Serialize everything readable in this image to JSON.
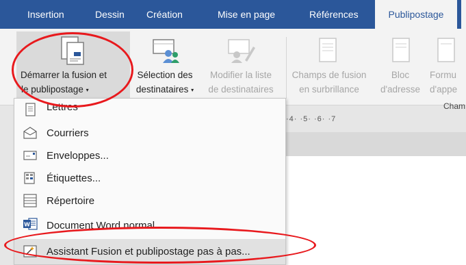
{
  "tabs": [
    {
      "label": "Insertion"
    },
    {
      "label": "Dessin"
    },
    {
      "label": "Création"
    },
    {
      "label": "Mise en page"
    },
    {
      "label": "Références"
    },
    {
      "label": "Publipostage",
      "active": true
    }
  ],
  "ribbon": {
    "start_merge": {
      "line1": "Démarrer la fusion et",
      "line2": "le publipostage"
    },
    "select_recipients": {
      "line1": "Sélection des",
      "line2": "destinataires"
    },
    "edit_list": {
      "line1": "Modifier la liste",
      "line2": "de destinataires"
    },
    "highlight_fields": {
      "line1": "Champs de fusion",
      "line2": "en surbrillance"
    },
    "address_block": {
      "line1": "Bloc",
      "line2": "d'adresse"
    },
    "formula": {
      "line1": "Formu",
      "line2": "d'appe"
    },
    "group_label": "Cham"
  },
  "ruler": {
    "text": "·4·  ·5·  ·6·  ·7"
  },
  "menu": {
    "items": [
      {
        "label": "Lettres",
        "icon": "letter-icon"
      },
      {
        "label": "Courriers",
        "icon": "email-icon"
      },
      {
        "label": "Enveloppes...",
        "icon": "envelope-icon"
      },
      {
        "label": "Étiquettes...",
        "icon": "labels-icon"
      },
      {
        "label": "Répertoire",
        "icon": "directory-icon"
      },
      {
        "label": "Document Word normal",
        "icon": "word-document-icon"
      },
      {
        "label": "Assistant Fusion et publipostage pas à pas...",
        "icon": "wizard-icon"
      }
    ]
  },
  "colors": {
    "accent": "#2b579a",
    "annotation": "#e8191d"
  }
}
